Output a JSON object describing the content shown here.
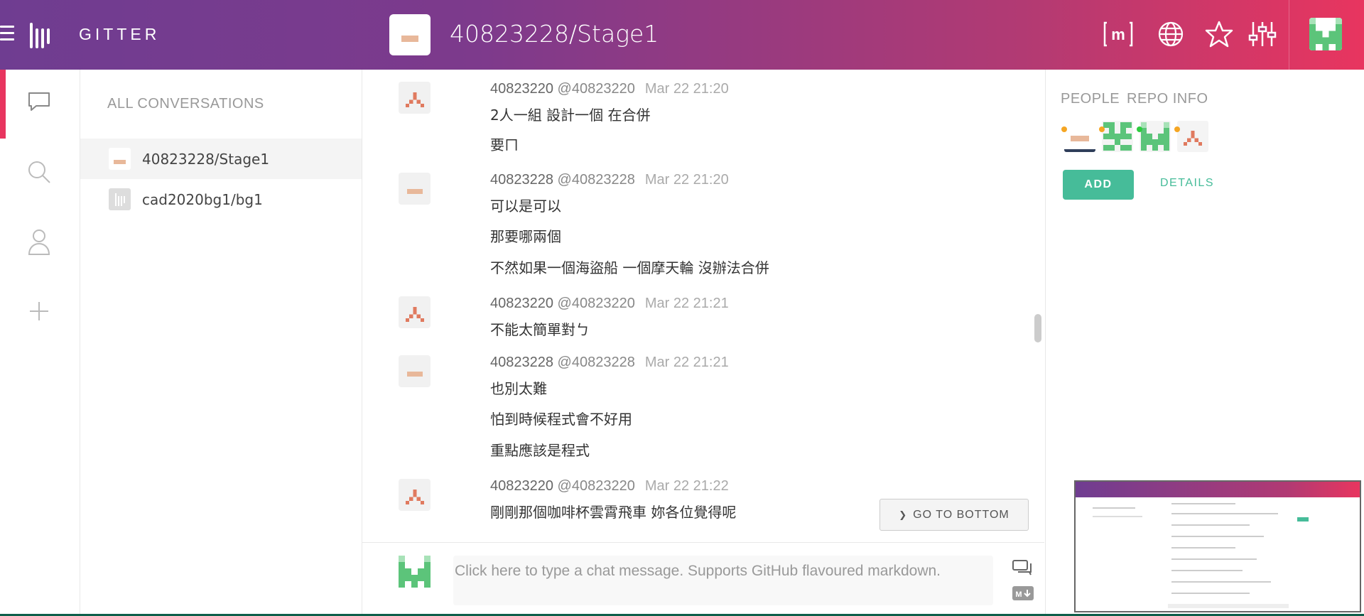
{
  "app": {
    "brand": "GITTER"
  },
  "header": {
    "room_title": "40823228/Stage1",
    "icons": [
      "matrix-icon",
      "globe-icon",
      "star-icon",
      "settings-sliders-icon"
    ]
  },
  "rail": {
    "icons": [
      "chat-bubble-icon",
      "search-icon",
      "person-icon",
      "plus-icon"
    ]
  },
  "conversations": {
    "title": "ALL CONVERSATIONS",
    "items": [
      {
        "label": "40823228/Stage1"
      },
      {
        "label": "cad2020bg1/bg1"
      }
    ]
  },
  "messages": [
    {
      "user": "40823220",
      "handle": "@40823220",
      "time": "Mar 22 21:20",
      "lines": [
        "2人一組 設計一個 在合併",
        "要ㄇ"
      ]
    },
    {
      "user": "40823228",
      "handle": "@40823228",
      "time": "Mar 22 21:20",
      "lines": [
        "可以是可以",
        "那要哪兩個",
        "不然如果一個海盜船 一個摩天輪 沒辦法合併"
      ]
    },
    {
      "user": "40823220",
      "handle": "@40823220",
      "time": "Mar 22 21:21",
      "lines": [
        "不能太簡單對ㄅ"
      ]
    },
    {
      "user": "40823228",
      "handle": "@40823228",
      "time": "Mar 22 21:21",
      "lines": [
        "也別太難",
        "怕到時候程式會不好用",
        "重點應該是程式"
      ]
    },
    {
      "user": "40823220",
      "handle": "@40823220",
      "time": "Mar 22 21:22",
      "lines": [
        "剛剛那個咖啡杯雲霄飛車 妳各位覺得呢"
      ]
    }
  ],
  "go_to_bottom": "GO TO BOTTOM",
  "composer": {
    "placeholder": "Click here to type a chat message. Supports GitHub flavoured markdown."
  },
  "right_panel": {
    "tabs": [
      "PEOPLE",
      "REPO INFO"
    ],
    "add_label": "ADD",
    "details_label": "DETAILS"
  },
  "colors": {
    "accent": "#46bc99",
    "active": "#e8355f",
    "header_start": "#6f3d91",
    "header_end": "#e8355f"
  }
}
